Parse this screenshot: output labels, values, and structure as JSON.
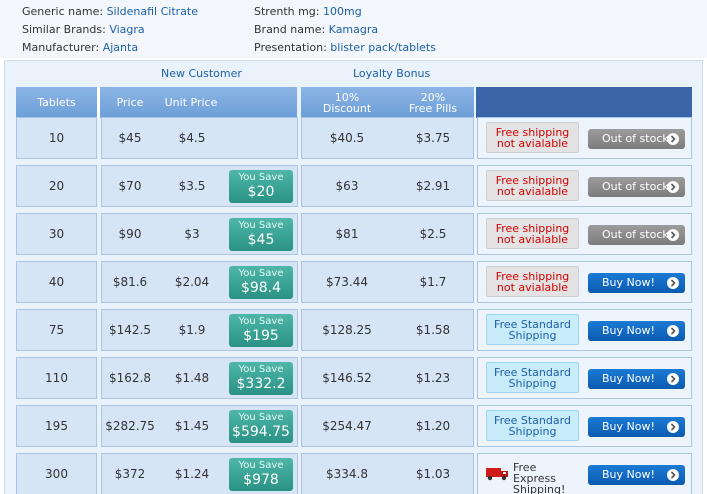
{
  "info": [
    {
      "label": "Generic name:",
      "value": "Sildenafil Citrate"
    },
    {
      "label": "Strenth mg:",
      "value": "100mg"
    },
    {
      "label": "Similar Brands:",
      "value": "Viagra"
    },
    {
      "label": "Brand name:",
      "value": "Kamagra"
    },
    {
      "label": "Manufacturer:",
      "value": "Ajanta"
    },
    {
      "label": "Presentation:",
      "value": "blister pack/tablets"
    }
  ],
  "sections": {
    "new_customer": "New Customer",
    "loyalty_bonus": "Loyalty Bonus"
  },
  "headers": {
    "tablets": "Tablets",
    "price": "Price",
    "unit_price": "Unit Price",
    "discount_pct": "10%",
    "discount": "Discount",
    "free_pct": "20%",
    "free_pills": "Free Pills"
  },
  "save_label": "You Save",
  "rows": [
    {
      "tablets": "10",
      "price": "$45",
      "unit": "$4.5",
      "save": "",
      "discount": "$40.5",
      "free": "$3.75",
      "ship1": "Free shipping",
      "ship2": "not avialable",
      "ship_type": "na",
      "button": "Out of stock",
      "btn_type": "oos"
    },
    {
      "tablets": "20",
      "price": "$70",
      "unit": "$3.5",
      "save": "$20",
      "discount": "$63",
      "free": "$2.91",
      "ship1": "Free shipping",
      "ship2": "not avialable",
      "ship_type": "na",
      "button": "Out of stock",
      "btn_type": "oos"
    },
    {
      "tablets": "30",
      "price": "$90",
      "unit": "$3",
      "save": "$45",
      "discount": "$81",
      "free": "$2.5",
      "ship1": "Free shipping",
      "ship2": "not avialable",
      "ship_type": "na",
      "button": "Out of stock",
      "btn_type": "oos"
    },
    {
      "tablets": "40",
      "price": "$81.6",
      "unit": "$2.04",
      "save": "$98.4",
      "discount": "$73.44",
      "free": "$1.7",
      "ship1": "Free shipping",
      "ship2": "not avialable",
      "ship_type": "na",
      "button": "Buy Now!",
      "btn_type": "buy"
    },
    {
      "tablets": "75",
      "price": "$142.5",
      "unit": "$1.9",
      "save": "$195",
      "discount": "$128.25",
      "free": "$1.58",
      "ship1": "Free Standard",
      "ship2": "Shipping",
      "ship_type": "std",
      "button": "Buy Now!",
      "btn_type": "buy"
    },
    {
      "tablets": "110",
      "price": "$162.8",
      "unit": "$1.48",
      "save": "$332.2",
      "discount": "$146.52",
      "free": "$1.23",
      "ship1": "Free Standard",
      "ship2": "Shipping",
      "ship_type": "std",
      "button": "Buy Now!",
      "btn_type": "buy"
    },
    {
      "tablets": "195",
      "price": "$282.75",
      "unit": "$1.45",
      "save": "$594.75",
      "discount": "$254.47",
      "free": "$1.20",
      "ship1": "Free Standard",
      "ship2": "Shipping",
      "ship_type": "std",
      "button": "Buy Now!",
      "btn_type": "buy"
    },
    {
      "tablets": "300",
      "price": "$372",
      "unit": "$1.24",
      "save": "$978",
      "discount": "$334.8",
      "free": "$1.03",
      "ship1": "Free Express",
      "ship2": "Shipping!",
      "ship_type": "exp",
      "button": "Buy Now!",
      "btn_type": "buy"
    }
  ],
  "icons": {
    "chevron": "chevron-right-icon",
    "truck": "truck-icon"
  },
  "colors": {
    "header_light": "#7aa9de",
    "header_dark": "#3a65a9",
    "save": "#2f9a8c",
    "buy": "#0f63bc",
    "oos": "#8a8a8a",
    "na_text": "#d10000"
  }
}
